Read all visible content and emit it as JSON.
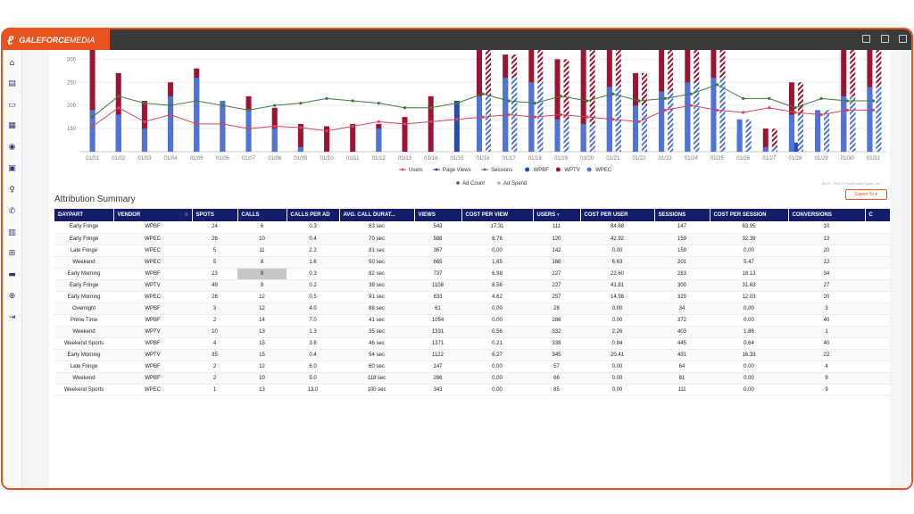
{
  "app": {
    "logo_gale": "GALEFORCE",
    "logo_media": "MEDIA"
  },
  "chart_data": {
    "type": "bar",
    "categories": [
      "01/01",
      "01/02",
      "01/03",
      "01/04",
      "01/05",
      "01/06",
      "01/07",
      "01/08",
      "01/09",
      "01/10",
      "01/11",
      "01/12",
      "01/13",
      "01/14",
      "01/15",
      "01/16",
      "01/17",
      "01/18",
      "01/19",
      "01/20",
      "01/21",
      "01/22",
      "01/23",
      "01/24",
      "01/25",
      "01/26",
      "01/27",
      "01/28",
      "01/29",
      "01/30",
      "01/31"
    ],
    "y_ticks": [
      "300",
      "250",
      "200",
      "150"
    ],
    "ylim": [
      100,
      320
    ],
    "series": [
      {
        "name": "WPBF",
        "color": "#2649b5",
        "values": [
          0,
          140,
          0,
          185,
          120,
          0,
          0,
          0,
          0,
          0,
          0,
          0,
          0,
          0,
          210,
          0,
          0,
          0,
          0,
          0,
          100,
          0,
          0,
          0,
          0,
          0,
          0,
          120,
          0,
          0,
          0
        ]
      },
      {
        "name": "WPTV",
        "color": "#9b1431",
        "values": [
          320,
          270,
          210,
          250,
          280,
          200,
          220,
          195,
          160,
          155,
          160,
          160,
          175,
          220,
          0,
          340,
          310,
          320,
          300,
          330,
          340,
          270,
          320,
          330,
          340,
          140,
          150,
          250,
          160,
          330,
          330
        ]
      },
      {
        "name": "WPEC",
        "color": "#4f74d8",
        "values": [
          190,
          180,
          150,
          220,
          260,
          210,
          190,
          150,
          110,
          0,
          0,
          150,
          0,
          0,
          0,
          220,
          260,
          250,
          170,
          160,
          240,
          200,
          230,
          250,
          260,
          170,
          110,
          180,
          190,
          220,
          240
        ]
      }
    ],
    "lines": [
      {
        "name": "Users",
        "color": "#d5465a",
        "values": [
          155,
          195,
          165,
          180,
          160,
          160,
          150,
          155,
          152,
          145,
          155,
          165,
          160,
          165,
          170,
          175,
          180,
          175,
          180,
          175,
          170,
          165,
          190,
          200,
          190,
          185,
          195,
          185,
          180,
          190,
          190
        ]
      },
      {
        "name": "Page Views",
        "color": "#1f3a8a",
        "values": []
      },
      {
        "name": "Sessions",
        "color": "#3d7a3d",
        "values": [
          175,
          220,
          205,
          200,
          210,
          200,
          190,
          200,
          205,
          215,
          210,
          205,
          195,
          195,
          205,
          225,
          210,
          205,
          220,
          210,
          225,
          210,
          215,
          225,
          245,
          215,
          215,
          195,
          215,
          210,
          210
        ]
      }
    ],
    "legend_row1": [
      "Users",
      "Page Views",
      "Sessions",
      "WPBF",
      "WPTV",
      "WPEC"
    ],
    "legend_row2": [
      "Ad Count",
      "Ad Spend"
    ],
    "grid": true,
    "legend_position": "bottom"
  },
  "copyright": "2019 - 2024 © GaleForce Digital, Inc.",
  "summary": {
    "title": "Attribution Summary",
    "export_label": "Export To ▾"
  },
  "table": {
    "columns": [
      "DAYPART",
      "VENDOR",
      "SPOTS",
      "CALLS",
      "CALLS PER AD",
      "AVG. CALL DURAT...",
      "VIEWS",
      "COST PER VIEW",
      "USERS",
      "COST PER USER",
      "SESSIONS",
      "COST PER SESSION",
      "CONVERSIONS",
      "C"
    ],
    "rows": [
      [
        "Early Fringe",
        "WPBF",
        "24",
        "6",
        "0.3",
        "63 sec",
        "543",
        "17.31",
        "111",
        "84.68",
        "147",
        "63.95",
        "10"
      ],
      [
        "Early Fringe",
        "WPEC",
        "26",
        "10",
        "0.4",
        "70 sec",
        "588",
        "8.76",
        "120",
        "42.92",
        "159",
        "32.39",
        "13"
      ],
      [
        "Late Fringe",
        "WPEC",
        "5",
        "11",
        "2.2",
        "81 sec",
        "367",
        "0.00",
        "142",
        "0.00",
        "159",
        "0.00",
        "20"
      ],
      [
        "Weekend",
        "WPEC",
        "5",
        "8",
        "1.6",
        "50 sec",
        "665",
        "1.65",
        "166",
        "6.63",
        "201",
        "5.47",
        "12"
      ],
      [
        "Early Morning",
        "WPBF",
        "23",
        "8",
        "0.3",
        "82 sec",
        "737",
        "6.98",
        "227",
        "22.60",
        "283",
        "18.13",
        "34"
      ],
      [
        "Early Fringe",
        "WPTV",
        "49",
        "9",
        "0.2",
        "39 sec",
        "1108",
        "8.56",
        "227",
        "41.81",
        "300",
        "31.63",
        "27"
      ],
      [
        "Early Morning",
        "WPEC",
        "26",
        "12",
        "0.5",
        "91 sec",
        "833",
        "4.62",
        "257",
        "14.98",
        "320",
        "12.03",
        "20"
      ],
      [
        "Overnight",
        "WPBF",
        "3",
        "12",
        "4.0",
        "88 sec",
        "61",
        "0.00",
        "28",
        "0.00",
        "34",
        "0.00",
        "3"
      ],
      [
        "Prime Time",
        "WPBF",
        "2",
        "14",
        "7.0",
        "41 sec",
        "1054",
        "0.00",
        "286",
        "0.00",
        "372",
        "0.00",
        "40"
      ],
      [
        "Weekend",
        "WPTV",
        "10",
        "13",
        "1.3",
        "35 sec",
        "1331",
        "0.56",
        "332",
        "2.26",
        "403",
        "1.86",
        "1"
      ],
      [
        "Weekend Sports",
        "WPBF",
        "4",
        "15",
        "3.8",
        "46 sec",
        "1371",
        "0.21",
        "338",
        "0.84",
        "445",
        "0.64",
        "40"
      ],
      [
        "Early Morning",
        "WPTV",
        "35",
        "15",
        "0.4",
        "54 sec",
        "1122",
        "6.27",
        "345",
        "20.41",
        "431",
        "16.33",
        "22"
      ],
      [
        "Late Fringe",
        "WPBF",
        "2",
        "12",
        "6.0",
        "60 sec",
        "147",
        "0.00",
        "57",
        "0.00",
        "64",
        "0.00",
        "4"
      ],
      [
        "Weekend",
        "WPBF",
        "2",
        "10",
        "5.0",
        "118 sec",
        "266",
        "0.00",
        "66",
        "0.00",
        "81",
        "0.00",
        "9"
      ],
      [
        "Weekend Sports",
        "WPEC",
        "1",
        "13",
        "13.0",
        "100 sec",
        "343",
        "0.00",
        "85",
        "0.00",
        "111",
        "0.00",
        "9"
      ]
    ]
  }
}
